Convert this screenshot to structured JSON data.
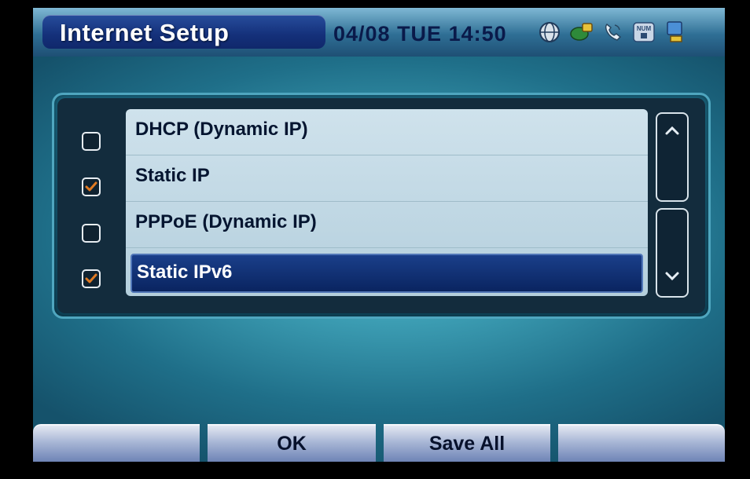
{
  "header": {
    "title": "Internet Setup",
    "clock": "04/08 TUE 14:50",
    "status_icons": [
      "globe-icon",
      "network-icon",
      "phone-icon",
      "num-lock-icon",
      "computer-icon"
    ],
    "num_label": "NUM"
  },
  "options": [
    {
      "label": "DHCP (Dynamic IP)",
      "checked": false,
      "selected": false
    },
    {
      "label": "Static IP",
      "checked": true,
      "selected": false
    },
    {
      "label": "PPPoE (Dynamic IP)",
      "checked": false,
      "selected": false
    },
    {
      "label": "Static IPv6",
      "checked": true,
      "selected": true
    }
  ],
  "scroll": {
    "up_icon": "chevron-up-icon",
    "down_icon": "chevron-down-icon"
  },
  "softkeys": [
    "",
    "OK",
    "Save All",
    ""
  ],
  "colors": {
    "check_accent": "#e07a22",
    "selection": "#0a2460"
  }
}
